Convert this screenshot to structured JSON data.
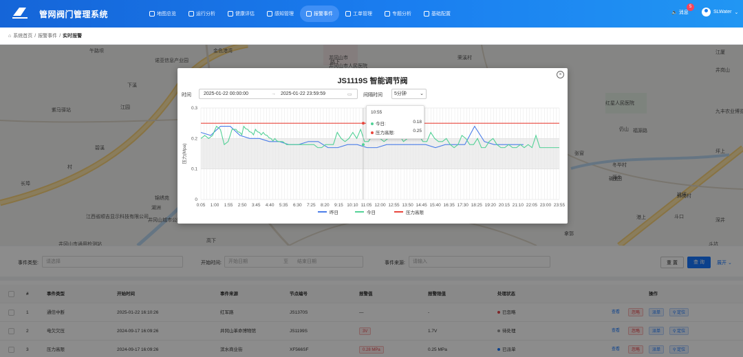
{
  "app": {
    "title": "管网阀门管理系统",
    "logo_icon": "logo-icon"
  },
  "nav": [
    {
      "label": "地图总览",
      "icon": "home-icon",
      "active": false
    },
    {
      "label": "运行分析",
      "icon": "pulse-icon",
      "active": false
    },
    {
      "label": "健康评估",
      "icon": "heart-icon",
      "active": false
    },
    {
      "label": "感知管理",
      "icon": "sensor-icon",
      "active": false
    },
    {
      "label": "报警事件",
      "icon": "bell-icon",
      "active": true
    },
    {
      "label": "工单管理",
      "icon": "document-icon",
      "active": false
    },
    {
      "label": "专题分析",
      "icon": "chart-icon",
      "active": false
    },
    {
      "label": "基础配置",
      "icon": "settings-icon",
      "active": false
    }
  ],
  "header": {
    "message_label": "消息",
    "message_count": "5",
    "username": "SLWater"
  },
  "breadcrumb": {
    "home": "系统首页",
    "section": "报警事件",
    "current": "实时报警"
  },
  "map_labels": [
    "午路坝",
    "金色港湾",
    "并冈山市",
    "荣溪村",
    "江厦",
    "诺亚信息产业园",
    "井冈山市人民医院",
    "井岗山",
    "下溪",
    "路下",
    "红星人民医院",
    "九丰农业博览园",
    "江园",
    "紫马驿站",
    "碧溪",
    "坪上",
    "村",
    "长埠",
    "张窗",
    "碗上",
    "仍山",
    "源头",
    "坑坪",
    "港上",
    "江西省顺吉显示科技有限公司",
    "拿郭",
    "井冈山市通用检测站",
    "斗口",
    "斗坑",
    "锦绣苑",
    "湖洲",
    "井冈山城市公园",
    "高下",
    "福源路",
    "深井",
    "冬毕村",
    "沙田",
    "斜岗村"
  ],
  "modal": {
    "title": "JS1119S 智能调节阀",
    "time_label": "时间",
    "start": "2025-01-22 00:00:00",
    "arrow": "→",
    "end": "2025-01-22 23:59:59",
    "interval_label": "间隔时间",
    "interval": "5分钟",
    "tooltip": {
      "time": "10:55",
      "today_label": "今日:",
      "today_value": "0.18",
      "limit_label": "压力高限:",
      "limit_value": "0.25"
    }
  },
  "chart_data": {
    "type": "line",
    "ylabel": "压力(Mpa)",
    "ylim": [
      0,
      0.3
    ],
    "yticks": [
      "0",
      "0.1",
      "0.2",
      "0.3"
    ],
    "xticks": [
      "0:05",
      "1:00",
      "1:55",
      "2:50",
      "3:45",
      "4:40",
      "5:35",
      "6:30",
      "7:25",
      "8:20",
      "9:15",
      "10:10",
      "11:05",
      "12:00",
      "12:55",
      "13:50",
      "14:45",
      "15:40",
      "16:35",
      "17:30",
      "18:25",
      "19:20",
      "20:15",
      "21:10",
      "22:05",
      "23:00",
      "23:55"
    ],
    "series": [
      {
        "name": "昨日",
        "color": "#4a7de8",
        "values": [
          0.22,
          0.21,
          0.24,
          0.24,
          0.21,
          0.2,
          0.2,
          0.19,
          0.19,
          0.18,
          0.18,
          0.19,
          0.19,
          0.17,
          0.17,
          0.18,
          0.18,
          0.17,
          0.17,
          0.18,
          0.18,
          0.18,
          0.18,
          0.18,
          0.17,
          0.18,
          0.18,
          0.18,
          0.24,
          0.19,
          0.18,
          0.18,
          0.18,
          0.18
        ]
      },
      {
        "name": "今日",
        "color": "#52d196",
        "values": [
          0.2,
          0.21,
          0.2,
          0.21,
          0.24,
          0.23,
          0.18,
          0.19,
          0.23,
          0.23,
          0.22,
          0.24,
          0.23,
          0.22,
          0.23,
          0.22,
          0.22,
          0.21,
          0.2,
          0.2,
          0.19,
          0.19,
          0.18,
          0.18,
          0.18,
          0.18,
          0.18,
          0.18,
          0.18,
          0.18,
          0.17,
          0.17,
          0.18,
          0.18,
          0.18,
          0.22,
          0.2,
          0.19,
          0.2,
          0.22,
          0.2,
          0.23,
          0.19,
          0.19,
          0.21,
          0.23,
          0.2,
          0.19,
          0.2,
          0.2,
          0.26,
          0.21,
          0.19,
          0.2,
          0.21,
          0.2,
          0.21,
          0.19,
          0.19,
          0.22,
          0.2,
          0.19,
          0.19,
          0.2,
          0.18,
          0.17,
          0.18,
          0.21,
          0.2,
          0.18,
          0.18,
          0.2,
          0.17,
          0.17,
          0.19,
          0.2,
          0.18,
          0.17,
          0.17,
          0.18,
          0.17,
          0.17,
          0.18,
          0.17,
          0.18,
          0.17,
          0.21,
          0.17,
          0.17,
          0.17,
          0.17,
          0.17,
          0.17
        ]
      },
      {
        "name": "压力高限",
        "color": "#e8453c",
        "values": [
          0.25,
          0.25
        ]
      }
    ],
    "grid": true,
    "legend": "bottom"
  },
  "filter": {
    "event_type_label": "事件类型:",
    "event_type_placeholder": "请选择",
    "start_time_label": "开始时间:",
    "start_placeholder": "开始日期",
    "end_placeholder": "结束日期",
    "range_sep": "至",
    "source_label": "事件来源:",
    "source_placeholder": "请输入",
    "reset": "重 置",
    "query": "查 询",
    "expand": "展开"
  },
  "table": {
    "headers": [
      "#",
      "事件类型",
      "开始时间",
      "事件来源",
      "节点编号",
      "报警值",
      "报警限值",
      "处理状态",
      "操作"
    ],
    "rows": [
      {
        "no": "1",
        "type": "通信中断",
        "time": "2025-01-22 16:10:26",
        "source": "红军路",
        "node": "JS1370S",
        "value": "—",
        "limit": "-",
        "status": "已忽略",
        "status_color": "#e5484d"
      },
      {
        "no": "2",
        "type": "电欠欠压",
        "time": "2024-09-17 16:09:26",
        "source": "井冈山革命博物馆",
        "node": "JS1199S",
        "value": "3V",
        "limit": "1.7V",
        "status": "待处理",
        "status_color": "#999999"
      },
      {
        "no": "3",
        "type": "压力高限",
        "time": "2024-09-17 16:09:26",
        "source": "滨水商业街",
        "node": "XF566SF",
        "value": "0.28 MPa",
        "limit": "0.25 MPa",
        "status": "已派单",
        "status_color": "#1677ff"
      }
    ],
    "actions": {
      "view": "查看",
      "ignore": "忽略",
      "dispatch": "派单",
      "locate": "定位"
    }
  }
}
